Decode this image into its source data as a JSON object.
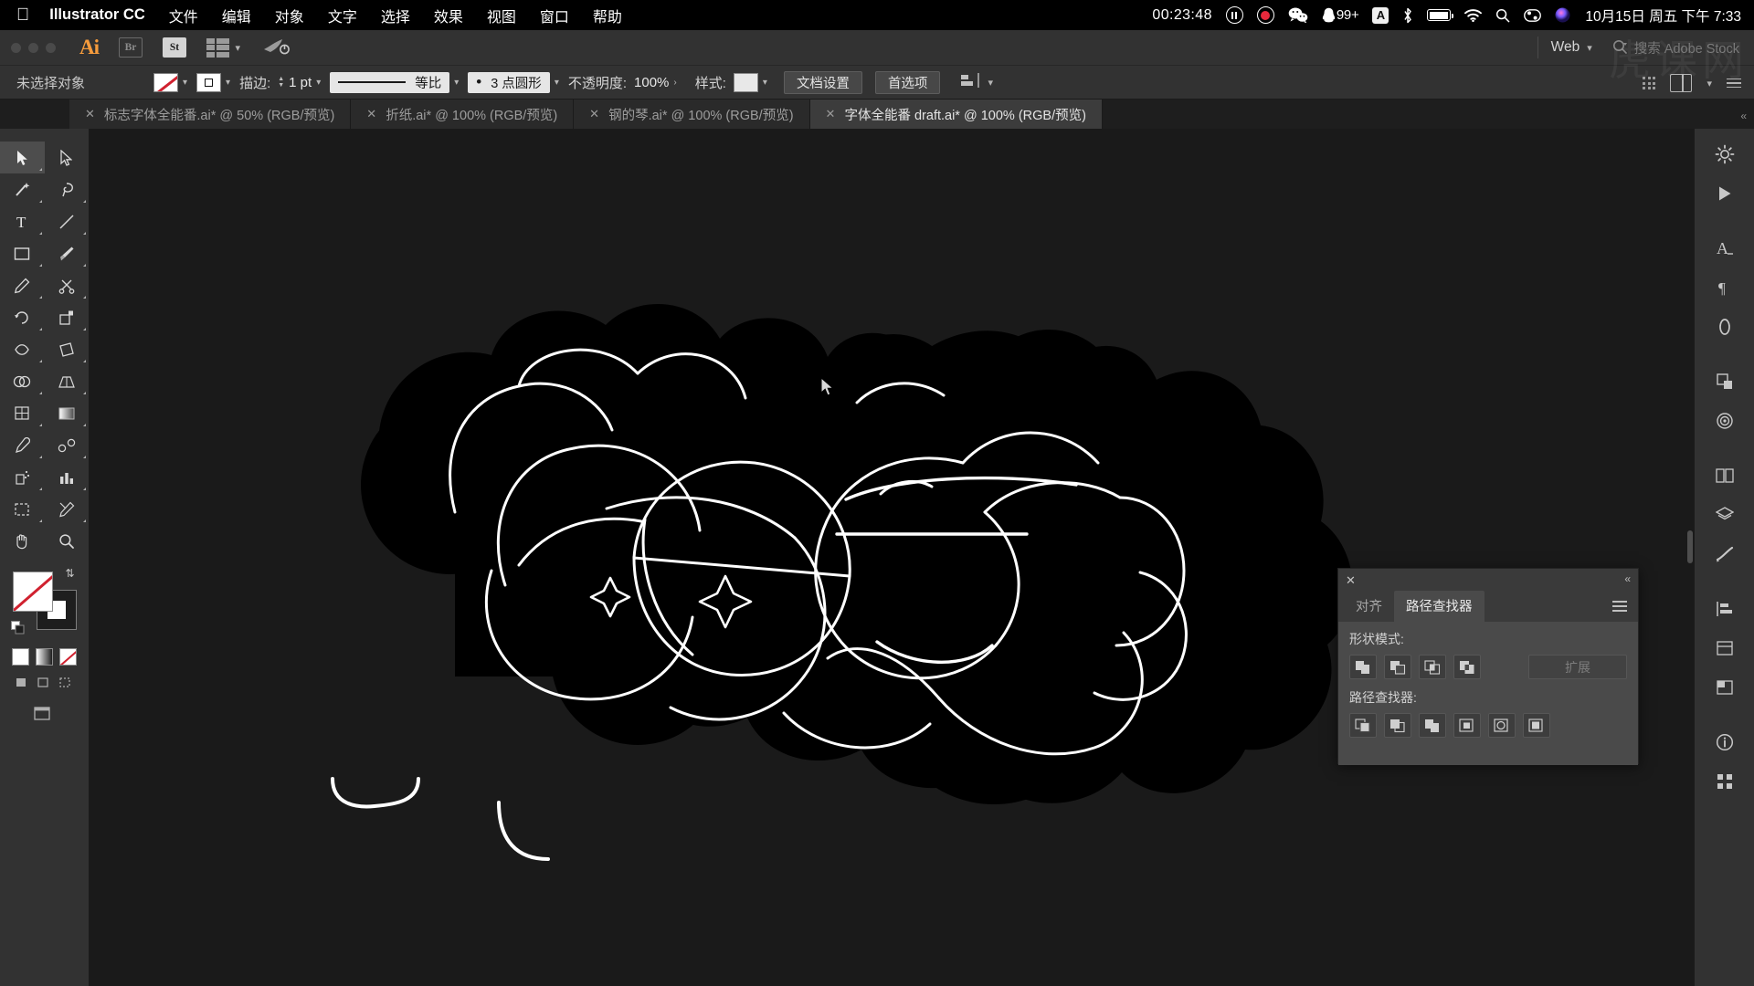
{
  "macbar": {
    "apple_icon": "apple-logo-icon",
    "app_name": "Illustrator CC",
    "menus": [
      "文件",
      "编辑",
      "对象",
      "文字",
      "选择",
      "效果",
      "视图",
      "窗口",
      "帮助"
    ],
    "rec_timer": "00:23:48",
    "pause_icon": "pause-icon",
    "record_icon": "record-icon",
    "wechat_icon": "wechat-icon",
    "qq_icon": "qq-icon",
    "qq_badge": "99+",
    "ime_label": "A",
    "bluetooth_icon": "bluetooth-icon",
    "battery_icon": "battery-charging-icon",
    "wifi_icon": "wifi-icon",
    "search_icon": "spotlight-search-icon",
    "control_center_icon": "control-center-icon",
    "siri_icon": "siri-icon",
    "datetime": "10月15日 周五 下午 7:33"
  },
  "appbar": {
    "ai_logo": "Ai",
    "bridge_label": "Br",
    "stock_label": "St",
    "workspace_icon": "workspace-switcher-icon",
    "rocket_icon": "rocket-icon",
    "workspace_name": "Web",
    "search_icon": "search-icon",
    "search_placeholder": "搜索 Adobe Stock"
  },
  "controlbar": {
    "selection_status": "未选择对象",
    "fill_swatch": "no-fill-swatch",
    "stroke_swatch": "stroke-swatch",
    "stroke_label": "描边:",
    "stroke_weight": "1 pt",
    "stroke_profile": "等比",
    "brush_definition": "3 点圆形",
    "opacity_label": "不透明度:",
    "opacity_value": "100%",
    "style_label": "样式:",
    "style_swatch": "graphic-style-swatch",
    "document_setup": "文档设置",
    "preferences": "首选项",
    "align_icon": "align-icon",
    "apps_grid_icon": "apps-grid-icon",
    "arrange_docs_icon": "arrange-documents-icon",
    "menu_icon": "hamburger-menu-icon"
  },
  "tabs": [
    {
      "label": "标志字体全能番.ai* @ 50% (RGB/预览)",
      "active": false
    },
    {
      "label": "折纸.ai* @ 100% (RGB/预览)",
      "active": false
    },
    {
      "label": "钢的琴.ai* @ 100% (RGB/预览)",
      "active": false
    },
    {
      "label": "字体全能番 draft.ai* @ 100% (RGB/预览)",
      "active": true
    }
  ],
  "toolbar": {
    "tools": [
      "selection-tool",
      "direct-selection-tool",
      "magic-wand-tool",
      "lasso-tool",
      "type-tool",
      "line-segment-tool",
      "rectangle-tool",
      "paintbrush-tool",
      "pencil-tool",
      "scissors-tool",
      "rotate-tool",
      "scale-tool",
      "width-tool",
      "free-transform-tool",
      "shape-builder-tool",
      "perspective-grid-tool",
      "mesh-tool",
      "gradient-tool",
      "eyedropper-tool",
      "blend-tool",
      "symbol-sprayer-tool",
      "column-graph-tool",
      "artboard-tool",
      "slice-tool",
      "hand-tool",
      "zoom-tool"
    ],
    "fill_swatch": "fill-none-swatch",
    "stroke_swatch": "stroke-white-swatch",
    "swap_icon": "swap-fill-stroke-icon",
    "reset_icon": "default-fill-stroke-icon",
    "color_mode_icons": [
      "color-swatch-icon",
      "gradient-icon",
      "none-icon"
    ],
    "draw_mode_icons": [
      "draw-normal-icon",
      "draw-behind-icon",
      "draw-inside-icon"
    ],
    "screen_mode_icon": "change-screen-mode-icon"
  },
  "dock": {
    "buttons": [
      "gear-settings-icon",
      "libraries-play-icon",
      "character-type-icon",
      "paragraph-icon",
      "stroke-panel-icon",
      "transform-icon",
      "gradient-panel-icon",
      "artboards-icon",
      "layers-icon",
      "brushes-icon",
      "align-panel-icon",
      "appearance-icon",
      "swatches-icon",
      "info-icon",
      "symbols-icon"
    ],
    "collapse_icon": "collapse-panels-icon"
  },
  "pathfinder": {
    "close_icon": "close-icon",
    "collapse_icon": "collapse-icon",
    "menu_icon": "panel-menu-icon",
    "tabs": [
      {
        "label": "对齐",
        "active": false
      },
      {
        "label": "路径查找器",
        "active": true
      }
    ],
    "shape_modes_label": "形状模式:",
    "shape_mode_icons": [
      "unite-icon",
      "minus-front-icon",
      "intersect-icon",
      "exclude-icon"
    ],
    "expand_label": "扩展",
    "pathfinders_label": "路径查找器:",
    "pathfinder_icons": [
      "divide-icon",
      "trim-icon",
      "merge-icon",
      "crop-icon",
      "outline-icon",
      "minus-back-icon"
    ]
  },
  "canvas": {
    "cursor_icon": "arrow-cursor",
    "artwork_description": "black-rounded-bubble-lettering-artwork"
  },
  "watermark": "虎课网"
}
